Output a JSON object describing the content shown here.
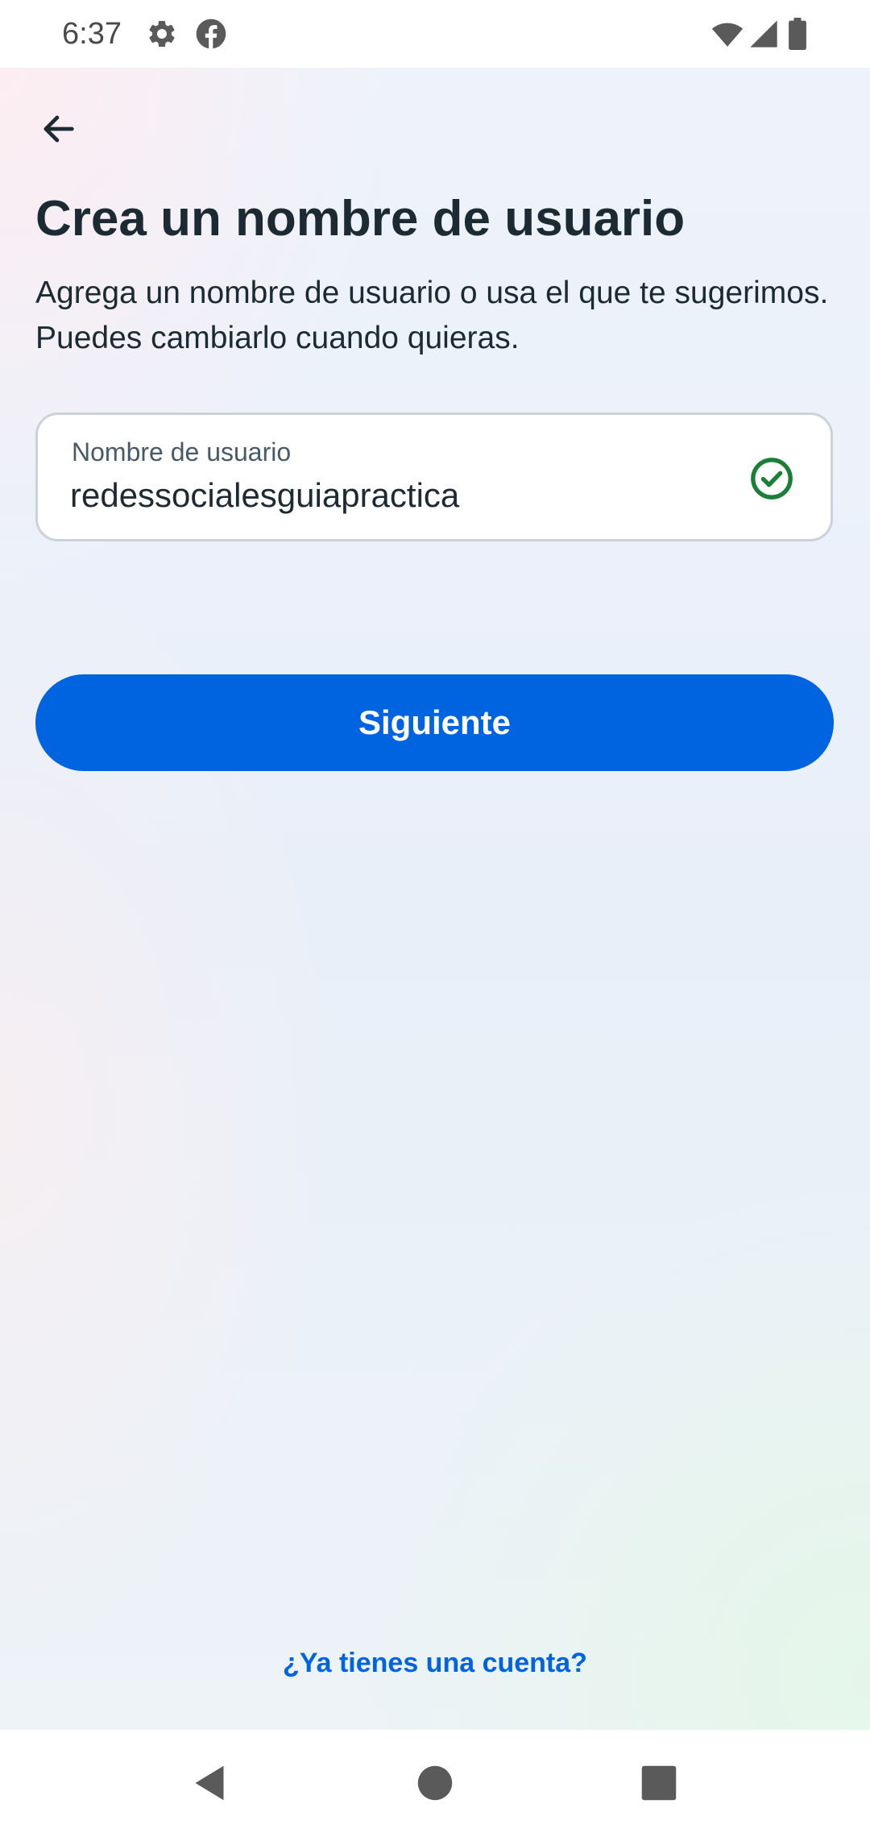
{
  "status_bar": {
    "time": "6:37",
    "icons": [
      "gear-icon",
      "facebook-icon",
      "wifi-icon",
      "signal-icon",
      "battery-icon"
    ]
  },
  "header": {
    "back_icon": "arrow-left-icon"
  },
  "main": {
    "title": "Crea un nombre de usuario",
    "subtitle": "Agrega un nombre de usuario o usa el que te sugerimos. Puedes cambiarlo cuando quieras.",
    "username_field": {
      "label": "Nombre de usuario",
      "value": "redessocialesguiapractica",
      "status_icon": "check-circle-icon",
      "status_color": "#1a7f37"
    },
    "next_button": {
      "label": "Siguiente",
      "color": "#0064e0"
    },
    "login_link": "¿Ya tienes una cuenta?"
  },
  "nav_bar": {
    "icons": [
      "back-triangle-icon",
      "home-circle-icon",
      "recents-square-icon"
    ]
  }
}
